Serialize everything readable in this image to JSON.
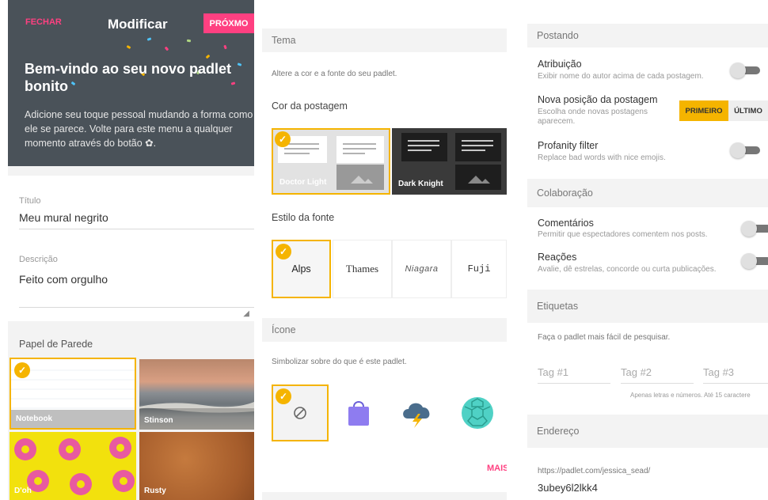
{
  "customize": {
    "close_label": "FECHAR",
    "title": "Modificar",
    "next_label": "PRÓXMO",
    "welcome_heading": "Bem-vindo ao seu novo padlet bonito",
    "intro_text": "Adicione seu toque pessoal mudando a forma como ele se parece. Volte para este menu a qualquer momento através do botão ✿.",
    "title_label": "Título",
    "title_value": "Meu mural negrito",
    "description_label": "Descrição",
    "description_value": "Feito com orgulho",
    "wallpaper_label": "Papel de Parede",
    "wallpapers": [
      {
        "name": "Notebook",
        "selected": true
      },
      {
        "name": "Stinson",
        "selected": false
      },
      {
        "name": "D'oh",
        "selected": false
      },
      {
        "name": "Rusty",
        "selected": false
      }
    ]
  },
  "appearance": {
    "theme_section": "Tema",
    "theme_desc": "Altere a cor e a fonte do seu padlet.",
    "post_color_label": "Cor da postagem",
    "themes": [
      {
        "name": "Doctor Light",
        "selected": true
      },
      {
        "name": "Dark Knight",
        "selected": false
      }
    ],
    "font_style_label": "Estilo da fonte",
    "fonts": [
      {
        "name": "Alps",
        "selected": true
      },
      {
        "name": "Thames",
        "selected": false
      },
      {
        "name": "Niagara",
        "selected": false
      },
      {
        "name": "Fuji",
        "selected": false
      }
    ],
    "icon_section": "Ícone",
    "icon_desc": "Simbolizar sobre do que é este padlet.",
    "icons": [
      "none-icon",
      "shopping-bag-icon",
      "storm-cloud-icon",
      "turtle-shell-icon"
    ],
    "more_label": "MAIS"
  },
  "settings": {
    "posting_section": "Postando",
    "attribution_title": "Atribuição",
    "attribution_sub": "Exibir nome do autor acima de cada postagem.",
    "new_post_title": "Nova posição da postagem",
    "new_post_sub": "Escolha onde novas postagens aparecem.",
    "new_post_first": "PRIMEIRO",
    "new_post_last": "ÚLTIMO",
    "profanity_title": "Profanity filter",
    "profanity_sub": "Replace bad words with nice emojis.",
    "collab_section": "Colaboração",
    "comments_title": "Comentários",
    "comments_sub": "Permitir que espectadores comentem nos posts.",
    "reactions_title": "Reações",
    "reactions_sub": "Avalie, dê estrelas, concorde ou curta publicações.",
    "tags_section": "Etiquetas",
    "tags_desc": "Faça o padlet mais fácil de pesquisar.",
    "tag_placeholders": [
      "Tag #1",
      "Tag #2",
      "Tag #3"
    ],
    "tags_hint": "Apenas letras e números. Até 15 caractere",
    "address_section": "Endereço",
    "address_prefix": "https://padlet.com/jessica_sead/",
    "address_slug": "3ubey6l2lkk4"
  },
  "colors": {
    "accent_pink": "#ff4081",
    "accent_yellow": "#f5b400",
    "header_dark": "#4a5259"
  }
}
